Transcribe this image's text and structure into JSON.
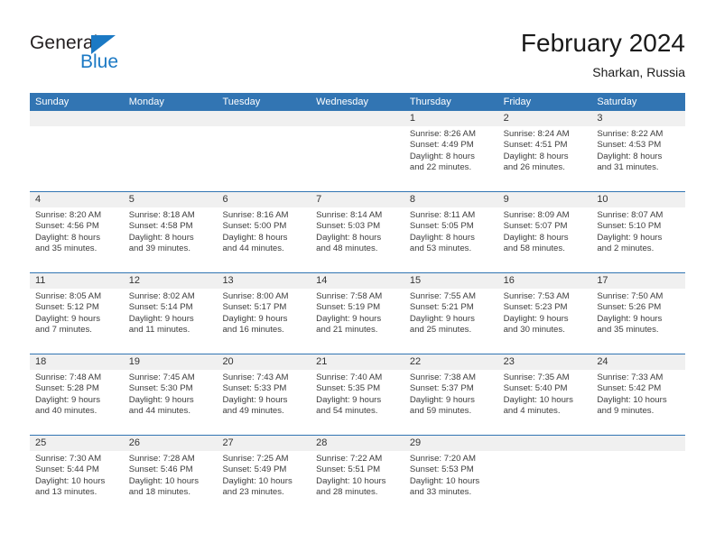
{
  "brand": {
    "name_line1": "General",
    "name_line2": "Blue",
    "triangle_icon": "triangle-icon",
    "accent_color": "#1b79c4"
  },
  "header": {
    "title": "February 2024",
    "subtitle": "Sharkan, Russia"
  },
  "theme": {
    "header_blue": "#3275b3",
    "daynum_band": "#f0f0f0",
    "text": "#333333"
  },
  "calendar": {
    "weekdays": [
      "Sunday",
      "Monday",
      "Tuesday",
      "Wednesday",
      "Thursday",
      "Friday",
      "Saturday"
    ],
    "weeks": [
      [
        {
          "day": "",
          "lines": []
        },
        {
          "day": "",
          "lines": []
        },
        {
          "day": "",
          "lines": []
        },
        {
          "day": "",
          "lines": []
        },
        {
          "day": "1",
          "lines": [
            "Sunrise: 8:26 AM",
            "Sunset: 4:49 PM",
            "Daylight: 8 hours",
            "and 22 minutes."
          ]
        },
        {
          "day": "2",
          "lines": [
            "Sunrise: 8:24 AM",
            "Sunset: 4:51 PM",
            "Daylight: 8 hours",
            "and 26 minutes."
          ]
        },
        {
          "day": "3",
          "lines": [
            "Sunrise: 8:22 AM",
            "Sunset: 4:53 PM",
            "Daylight: 8 hours",
            "and 31 minutes."
          ]
        }
      ],
      [
        {
          "day": "4",
          "lines": [
            "Sunrise: 8:20 AM",
            "Sunset: 4:56 PM",
            "Daylight: 8 hours",
            "and 35 minutes."
          ]
        },
        {
          "day": "5",
          "lines": [
            "Sunrise: 8:18 AM",
            "Sunset: 4:58 PM",
            "Daylight: 8 hours",
            "and 39 minutes."
          ]
        },
        {
          "day": "6",
          "lines": [
            "Sunrise: 8:16 AM",
            "Sunset: 5:00 PM",
            "Daylight: 8 hours",
            "and 44 minutes."
          ]
        },
        {
          "day": "7",
          "lines": [
            "Sunrise: 8:14 AM",
            "Sunset: 5:03 PM",
            "Daylight: 8 hours",
            "and 48 minutes."
          ]
        },
        {
          "day": "8",
          "lines": [
            "Sunrise: 8:11 AM",
            "Sunset: 5:05 PM",
            "Daylight: 8 hours",
            "and 53 minutes."
          ]
        },
        {
          "day": "9",
          "lines": [
            "Sunrise: 8:09 AM",
            "Sunset: 5:07 PM",
            "Daylight: 8 hours",
            "and 58 minutes."
          ]
        },
        {
          "day": "10",
          "lines": [
            "Sunrise: 8:07 AM",
            "Sunset: 5:10 PM",
            "Daylight: 9 hours",
            "and 2 minutes."
          ]
        }
      ],
      [
        {
          "day": "11",
          "lines": [
            "Sunrise: 8:05 AM",
            "Sunset: 5:12 PM",
            "Daylight: 9 hours",
            "and 7 minutes."
          ]
        },
        {
          "day": "12",
          "lines": [
            "Sunrise: 8:02 AM",
            "Sunset: 5:14 PM",
            "Daylight: 9 hours",
            "and 11 minutes."
          ]
        },
        {
          "day": "13",
          "lines": [
            "Sunrise: 8:00 AM",
            "Sunset: 5:17 PM",
            "Daylight: 9 hours",
            "and 16 minutes."
          ]
        },
        {
          "day": "14",
          "lines": [
            "Sunrise: 7:58 AM",
            "Sunset: 5:19 PM",
            "Daylight: 9 hours",
            "and 21 minutes."
          ]
        },
        {
          "day": "15",
          "lines": [
            "Sunrise: 7:55 AM",
            "Sunset: 5:21 PM",
            "Daylight: 9 hours",
            "and 25 minutes."
          ]
        },
        {
          "day": "16",
          "lines": [
            "Sunrise: 7:53 AM",
            "Sunset: 5:23 PM",
            "Daylight: 9 hours",
            "and 30 minutes."
          ]
        },
        {
          "day": "17",
          "lines": [
            "Sunrise: 7:50 AM",
            "Sunset: 5:26 PM",
            "Daylight: 9 hours",
            "and 35 minutes."
          ]
        }
      ],
      [
        {
          "day": "18",
          "lines": [
            "Sunrise: 7:48 AM",
            "Sunset: 5:28 PM",
            "Daylight: 9 hours",
            "and 40 minutes."
          ]
        },
        {
          "day": "19",
          "lines": [
            "Sunrise: 7:45 AM",
            "Sunset: 5:30 PM",
            "Daylight: 9 hours",
            "and 44 minutes."
          ]
        },
        {
          "day": "20",
          "lines": [
            "Sunrise: 7:43 AM",
            "Sunset: 5:33 PM",
            "Daylight: 9 hours",
            "and 49 minutes."
          ]
        },
        {
          "day": "21",
          "lines": [
            "Sunrise: 7:40 AM",
            "Sunset: 5:35 PM",
            "Daylight: 9 hours",
            "and 54 minutes."
          ]
        },
        {
          "day": "22",
          "lines": [
            "Sunrise: 7:38 AM",
            "Sunset: 5:37 PM",
            "Daylight: 9 hours",
            "and 59 minutes."
          ]
        },
        {
          "day": "23",
          "lines": [
            "Sunrise: 7:35 AM",
            "Sunset: 5:40 PM",
            "Daylight: 10 hours",
            "and 4 minutes."
          ]
        },
        {
          "day": "24",
          "lines": [
            "Sunrise: 7:33 AM",
            "Sunset: 5:42 PM",
            "Daylight: 10 hours",
            "and 9 minutes."
          ]
        }
      ],
      [
        {
          "day": "25",
          "lines": [
            "Sunrise: 7:30 AM",
            "Sunset: 5:44 PM",
            "Daylight: 10 hours",
            "and 13 minutes."
          ]
        },
        {
          "day": "26",
          "lines": [
            "Sunrise: 7:28 AM",
            "Sunset: 5:46 PM",
            "Daylight: 10 hours",
            "and 18 minutes."
          ]
        },
        {
          "day": "27",
          "lines": [
            "Sunrise: 7:25 AM",
            "Sunset: 5:49 PM",
            "Daylight: 10 hours",
            "and 23 minutes."
          ]
        },
        {
          "day": "28",
          "lines": [
            "Sunrise: 7:22 AM",
            "Sunset: 5:51 PM",
            "Daylight: 10 hours",
            "and 28 minutes."
          ]
        },
        {
          "day": "29",
          "lines": [
            "Sunrise: 7:20 AM",
            "Sunset: 5:53 PM",
            "Daylight: 10 hours",
            "and 33 minutes."
          ]
        },
        {
          "day": "",
          "lines": []
        },
        {
          "day": "",
          "lines": []
        }
      ]
    ]
  }
}
